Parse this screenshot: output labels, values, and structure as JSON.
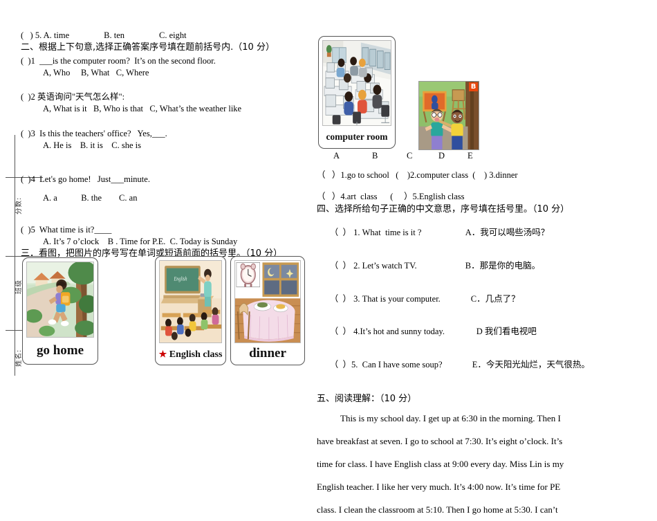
{
  "margin": {
    "score_label": "分数:",
    "class_label": "班级",
    "name_label": "姓名:"
  },
  "left_column": {
    "q1_5_prev": "(   ) 5. A. time                B. ten                C. eight",
    "section2_heading": "二、根据上下句意,选择正确答案序号填在题前括号内.（10 分）",
    "items": [
      {
        "stem": "(  )1  ___is the computer room?  It’s on the second floor.",
        "options": "A, Who     B, What   C, Where"
      },
      {
        "stem": "(  )2 英语询问\"天气怎么样\":",
        "options": "A, What is it   B, Who is that   C, What’s the weather like"
      },
      {
        "stem": "(  )3  Is this the teachers' office?   Yes,___.",
        "options": "A. He is    B. it is    C. she is"
      },
      {
        "stem": "(  )4  Let's go home!   Just___minute.",
        "options": "A. a           B. the        C. an"
      },
      {
        "stem": "(  )5  What time is it?____",
        "options": "A. It’s 7 o’clock    B . Time for P.E.  C. Today is Sunday"
      }
    ],
    "section3_heading": "三．看图，把图片的序号写在单词或短语前面的括号里。（10 分）"
  },
  "picture_cards": [
    {
      "id": "go-home",
      "caption": "go home",
      "star": false
    },
    {
      "id": "english-class",
      "caption": "English class",
      "star": true
    },
    {
      "id": "dinner",
      "caption": "dinner",
      "star": false
    },
    {
      "id": "computer-room",
      "caption": "computer room",
      "star": false
    },
    {
      "id": "art-class",
      "caption": "",
      "star": false,
      "badge": "B"
    }
  ],
  "right_column": {
    "letters": [
      "A",
      "B",
      "C",
      "D",
      "E"
    ],
    "matching_line1": "（   ）1.go to school   (    )2.computer class  (    ) 3.dinner",
    "matching_line2": "（   ）4.art  class      (     ）5.English class",
    "section4_heading": "四、选择所给句子正确的中文意思，序号填在括号里。（10 分）",
    "section4_items": [
      {
        "en": "（  ） 1. What  time is it ?",
        "zh": "A．我可以喝些汤吗？"
      },
      {
        "en": "（  ） 2. Let’s watch TV.",
        "zh": "B．那是你的电脑。"
      },
      {
        "en": "（  ） 3. That is your computer.",
        "zh": "C．几点了？"
      },
      {
        "en": "（  ） 4.It’s hot and sunny today.",
        "zh": "D 我们看电视吧"
      },
      {
        "en": "（  ）5.  Can I have some soup?",
        "zh": "E．今天阳光灿烂，天气很热。"
      }
    ],
    "section5_heading": "五、阅读理解：（10 分）",
    "reading_lines": [
      "This is my school day. I get up at 6:30 in the morning. Then I",
      "have breakfast at seven. I go to school at 7:30. It’s eight o’clock. It’s",
      "time for class. I have English class at 9:00 every day. Miss Lin is my",
      "English teacher. I like her very much. It’s 4:00 now. It’s time for PE",
      "class. I clean the classroom at 5:10. Then I go home at 5:30. I can’t"
    ]
  },
  "colors": {
    "badge_orange": "#e8480f",
    "star_red": "#cc0000",
    "rule_gray": "#555555"
  }
}
